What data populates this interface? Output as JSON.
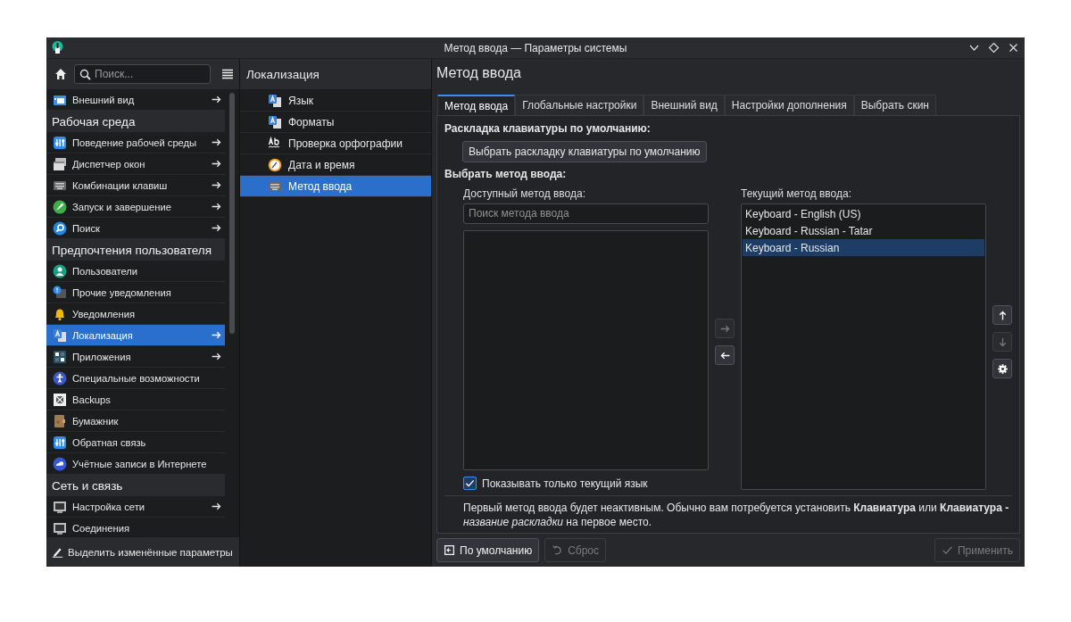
{
  "window": {
    "title": "Метод ввода — Параметры системы"
  },
  "sidebar": {
    "search": {
      "placeholder": "Поиск..."
    },
    "items": [
      {
        "kind": "item",
        "label": "Внешний вид",
        "has_children": true,
        "selected": false
      },
      {
        "kind": "section",
        "label": "Рабочая среда"
      },
      {
        "kind": "item",
        "label": "Поведение рабочей среды",
        "has_children": true,
        "selected": false
      },
      {
        "kind": "item",
        "label": "Диспетчер окон",
        "has_children": true,
        "selected": false
      },
      {
        "kind": "item",
        "label": "Комбинации клавиш",
        "has_children": true,
        "selected": false
      },
      {
        "kind": "item",
        "label": "Запуск и завершение",
        "has_children": true,
        "selected": false
      },
      {
        "kind": "item",
        "label": "Поиск",
        "has_children": true,
        "selected": false
      },
      {
        "kind": "section",
        "label": "Предпочтения пользователя"
      },
      {
        "kind": "item",
        "label": "Пользователи",
        "has_children": false,
        "selected": false
      },
      {
        "kind": "item",
        "label": "Прочие уведомления",
        "has_children": false,
        "selected": false
      },
      {
        "kind": "item",
        "label": "Уведомления",
        "has_children": false,
        "selected": false
      },
      {
        "kind": "item",
        "label": "Локализация",
        "has_children": true,
        "selected": true
      },
      {
        "kind": "item",
        "label": "Приложения",
        "has_children": true,
        "selected": false
      },
      {
        "kind": "item",
        "label": "Специальные возможности",
        "has_children": false,
        "selected": false
      },
      {
        "kind": "item",
        "label": "Backups",
        "has_children": false,
        "selected": false
      },
      {
        "kind": "item",
        "label": "Бумажник",
        "has_children": false,
        "selected": false
      },
      {
        "kind": "item",
        "label": "Обратная связь",
        "has_children": false,
        "selected": false
      },
      {
        "kind": "item",
        "label": "Учётные записи в Интернете",
        "has_children": false,
        "selected": false
      },
      {
        "kind": "section",
        "label": "Сеть и связь"
      },
      {
        "kind": "item",
        "label": "Настройка сети",
        "has_children": true,
        "selected": false
      },
      {
        "kind": "item",
        "label": "Соединения",
        "has_children": false,
        "selected": false
      }
    ],
    "footer_button": "Выделить изменённые параметры"
  },
  "subcategory": {
    "title": "Локализация",
    "items": [
      {
        "label": "Язык",
        "selected": false
      },
      {
        "label": "Форматы",
        "selected": false
      },
      {
        "label": "Проверка орфографии",
        "selected": false
      },
      {
        "label": "Дата и время",
        "selected": false
      },
      {
        "label": "Метод ввода",
        "selected": true
      }
    ]
  },
  "page": {
    "title": "Метод ввода",
    "tabs": [
      {
        "label": "Метод ввода",
        "selected": true
      },
      {
        "label": "Глобальные настройки",
        "selected": false
      },
      {
        "label": "Внешний вид",
        "selected": false
      },
      {
        "label": "Настройки дополнения",
        "selected": false
      },
      {
        "label": "Выбрать скин",
        "selected": false
      }
    ],
    "keyboard_heading": "Раскладка клавиатуры по умолчанию:",
    "keyboard_button": "Выбрать раскладку клавиатуры по умолчанию",
    "input_heading": "Выбрать метод ввода:",
    "available": {
      "label": "Доступный метод ввода:",
      "placeholder": "Поиск метода ввода"
    },
    "current": {
      "label": "Текущий метод ввода:",
      "items": [
        {
          "label": "Keyboard - English (US)",
          "selected": false
        },
        {
          "label": "Keyboard - Russian - Tatar",
          "selected": false
        },
        {
          "label": "Keyboard - Russian",
          "selected": true
        }
      ]
    },
    "transfer_buttons": [
      {
        "kind": "add",
        "disabled": true
      },
      {
        "kind": "remove",
        "disabled": false
      }
    ],
    "order_buttons": [
      {
        "kind": "up",
        "disabled": false
      },
      {
        "kind": "down",
        "disabled": true
      },
      {
        "kind": "configure",
        "disabled": false
      }
    ],
    "only_current_language": {
      "label": "Показывать только текущий язык",
      "checked": true
    },
    "note": "Первый метод ввода будет неактивным. Обычно вам потребуется установить **Клавиатура** или **Клавиатура -** *название раскладки* на первое место.",
    "footer_buttons": [
      {
        "kind": "defaults",
        "label": "По умолчанию",
        "disabled": false
      },
      {
        "kind": "reset",
        "label": "Сброс",
        "disabled": true
      },
      {
        "kind": "apply",
        "label": "Применить",
        "disabled": true
      }
    ]
  }
}
